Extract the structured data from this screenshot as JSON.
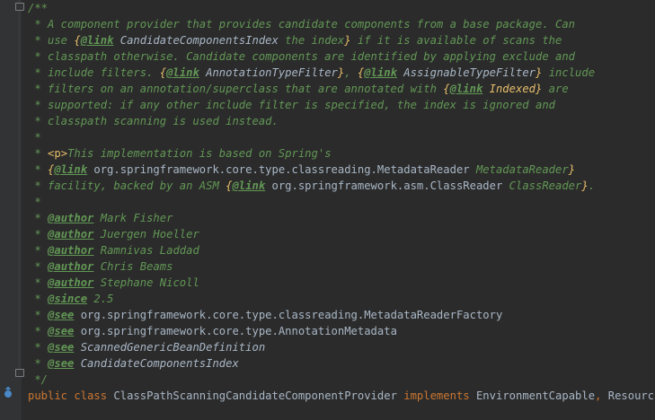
{
  "lines": [
    {
      "segments": [
        {
          "t": "/**",
          "k": "c"
        }
      ]
    },
    {
      "segments": [
        {
          "t": " * A component provider that provides candidate components from a base package. Can",
          "k": "c"
        }
      ]
    },
    {
      "segments": [
        {
          "t": " * use ",
          "k": "c"
        },
        {
          "t": "{",
          "k": "brace"
        },
        {
          "t": "@link",
          "k": "tag"
        },
        {
          "t": " CandidateComponentsIndex",
          "k": "refi"
        },
        {
          "t": " the index",
          "k": "c"
        },
        {
          "t": "}",
          "k": "brace"
        },
        {
          "t": " if it is available of scans the",
          "k": "c"
        }
      ]
    },
    {
      "segments": [
        {
          "t": " * classpath otherwise. Candidate components are identified by applying exclude and",
          "k": "c"
        }
      ]
    },
    {
      "segments": [
        {
          "t": " * include filters. ",
          "k": "c"
        },
        {
          "t": "{",
          "k": "brace"
        },
        {
          "t": "@link",
          "k": "tag"
        },
        {
          "t": " AnnotationTypeFilter",
          "k": "refi"
        },
        {
          "t": "}",
          "k": "brace"
        },
        {
          "t": ", ",
          "k": "c"
        },
        {
          "t": "{",
          "k": "brace"
        },
        {
          "t": "@link",
          "k": "tag"
        },
        {
          "t": " AssignableTypeFilter",
          "k": "refi"
        },
        {
          "t": "}",
          "k": "brace"
        },
        {
          "t": " include",
          "k": "c"
        }
      ]
    },
    {
      "segments": [
        {
          "t": " * filters on an annotation/superclass that are annotated with ",
          "k": "c"
        },
        {
          "t": "{",
          "k": "brace"
        },
        {
          "t": "@link",
          "k": "tag"
        },
        {
          "t": " Indexed",
          "k": "idx"
        },
        {
          "t": "}",
          "k": "brace"
        },
        {
          "t": " are",
          "k": "c"
        }
      ]
    },
    {
      "segments": [
        {
          "t": " * supported: if any other include filter is specified, the index is ignored and",
          "k": "c"
        }
      ]
    },
    {
      "segments": [
        {
          "t": " * classpath scanning is used instead.",
          "k": "c"
        }
      ]
    },
    {
      "segments": [
        {
          "t": " *",
          "k": "c"
        }
      ]
    },
    {
      "segments": [
        {
          "t": " * ",
          "k": "c"
        },
        {
          "t": "<p>",
          "k": "html"
        },
        {
          "t": "This implementation is based on Spring's",
          "k": "c"
        }
      ]
    },
    {
      "segments": [
        {
          "t": " * ",
          "k": "c"
        },
        {
          "t": "{",
          "k": "brace"
        },
        {
          "t": "@link",
          "k": "tag"
        },
        {
          "t": " org.springframework.core.type.classreading.MetadataReader",
          "k": "ref"
        },
        {
          "t": " MetadataReader",
          "k": "c"
        },
        {
          "t": "}",
          "k": "brace"
        }
      ]
    },
    {
      "segments": [
        {
          "t": " * facility, backed by an ASM ",
          "k": "c"
        },
        {
          "t": "{",
          "k": "brace"
        },
        {
          "t": "@link",
          "k": "tag"
        },
        {
          "t": " org.springframework.asm.ClassReader",
          "k": "ref"
        },
        {
          "t": " ClassReader",
          "k": "c"
        },
        {
          "t": "}",
          "k": "brace"
        },
        {
          "t": ".",
          "k": "c"
        }
      ]
    },
    {
      "segments": [
        {
          "t": " *",
          "k": "c"
        }
      ]
    },
    {
      "segments": [
        {
          "t": " * ",
          "k": "c"
        },
        {
          "t": "@author",
          "k": "tag"
        },
        {
          "t": " Mark Fisher",
          "k": "c"
        }
      ]
    },
    {
      "segments": [
        {
          "t": " * ",
          "k": "c"
        },
        {
          "t": "@author",
          "k": "tag"
        },
        {
          "t": " Juergen Hoeller",
          "k": "c"
        }
      ]
    },
    {
      "segments": [
        {
          "t": " * ",
          "k": "c"
        },
        {
          "t": "@author",
          "k": "tag"
        },
        {
          "t": " Ramnivas Laddad",
          "k": "c"
        }
      ]
    },
    {
      "segments": [
        {
          "t": " * ",
          "k": "c"
        },
        {
          "t": "@author",
          "k": "tag"
        },
        {
          "t": " Chris Beams",
          "k": "c"
        }
      ]
    },
    {
      "segments": [
        {
          "t": " * ",
          "k": "c"
        },
        {
          "t": "@author",
          "k": "tag"
        },
        {
          "t": " Stephane Nicoll",
          "k": "c"
        }
      ]
    },
    {
      "segments": [
        {
          "t": " * ",
          "k": "c"
        },
        {
          "t": "@since",
          "k": "tag"
        },
        {
          "t": " 2.5",
          "k": "c"
        }
      ]
    },
    {
      "segments": [
        {
          "t": " * ",
          "k": "c"
        },
        {
          "t": "@see",
          "k": "tag"
        },
        {
          "t": " org.springframework.core.type.classreading.MetadataReaderFactory",
          "k": "ref"
        }
      ]
    },
    {
      "segments": [
        {
          "t": " * ",
          "k": "c"
        },
        {
          "t": "@see",
          "k": "tag"
        },
        {
          "t": " org.springframework.core.type.AnnotationMetadata",
          "k": "ref"
        }
      ]
    },
    {
      "segments": [
        {
          "t": " * ",
          "k": "c"
        },
        {
          "t": "@see",
          "k": "tag"
        },
        {
          "t": " ScannedGenericBeanDefinition",
          "k": "refi"
        }
      ]
    },
    {
      "segments": [
        {
          "t": " * ",
          "k": "c"
        },
        {
          "t": "@see",
          "k": "tag"
        },
        {
          "t": " CandidateComponentsIndex",
          "k": "refi"
        }
      ]
    },
    {
      "segments": [
        {
          "t": " */",
          "k": "c"
        }
      ]
    },
    {
      "segments": [
        {
          "t": "public class ",
          "k": "kw"
        },
        {
          "t": "ClassPathScanningCandidateComponentProvider ",
          "k": "plain"
        },
        {
          "t": "implements ",
          "k": "kw"
        },
        {
          "t": "EnvironmentCapable",
          "k": "plain"
        },
        {
          "t": ", ",
          "k": "kw"
        },
        {
          "t": "ResourceLoad",
          "k": "plain"
        }
      ]
    }
  ],
  "gutter": {
    "icon": "implemented-interface-icon",
    "icon_color": "#4a88c7"
  },
  "colors": {
    "background": "#2b2b2b",
    "gutter": "#313335",
    "comment": "#629755",
    "keyword": "#cc7832",
    "identifier": "#a9b7c6",
    "html_tag": "#e8bf6a"
  }
}
